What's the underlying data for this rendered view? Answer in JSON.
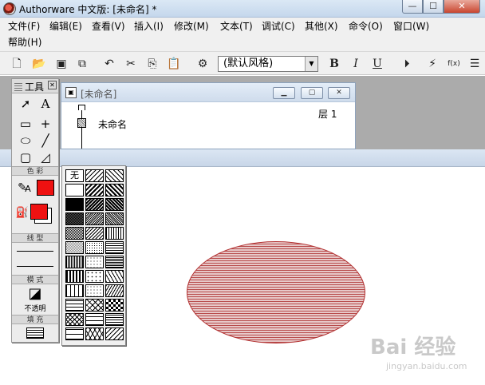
{
  "window": {
    "title": "Authorware 中文版: [未命名] *",
    "min_glyph": "—",
    "max_glyph": "☐",
    "close_glyph": "✕"
  },
  "menu": {
    "items": [
      "文件(F)",
      "编辑(E)",
      "查看(V)",
      "插入(I)",
      "修改(M)",
      "文本(T)",
      "调试(C)",
      "其他(X)",
      "命令(O)",
      "窗口(W)",
      "帮助(H)"
    ]
  },
  "toolbar": {
    "style_select_value": "(默认风格)",
    "bold": "B",
    "italic": "I",
    "underline": "U"
  },
  "flowline": {
    "title": "[未命名]",
    "level_label": "层 1",
    "file_label": "未命名"
  },
  "tools": {
    "title": "工具",
    "color_label": "色 彩",
    "line_label": "线 型",
    "mode_label": "模 式",
    "mode_value": "不透明",
    "fill_label": "填 充"
  },
  "pattern": {
    "none_label": "无"
  },
  "colors": {
    "fill_color": "#ee1111",
    "ellipse_stroke": "#b22f2f",
    "pattern_black": "#000000"
  },
  "watermark": {
    "logo": "Bai 经验",
    "url": "jingyan.baidu.com"
  }
}
